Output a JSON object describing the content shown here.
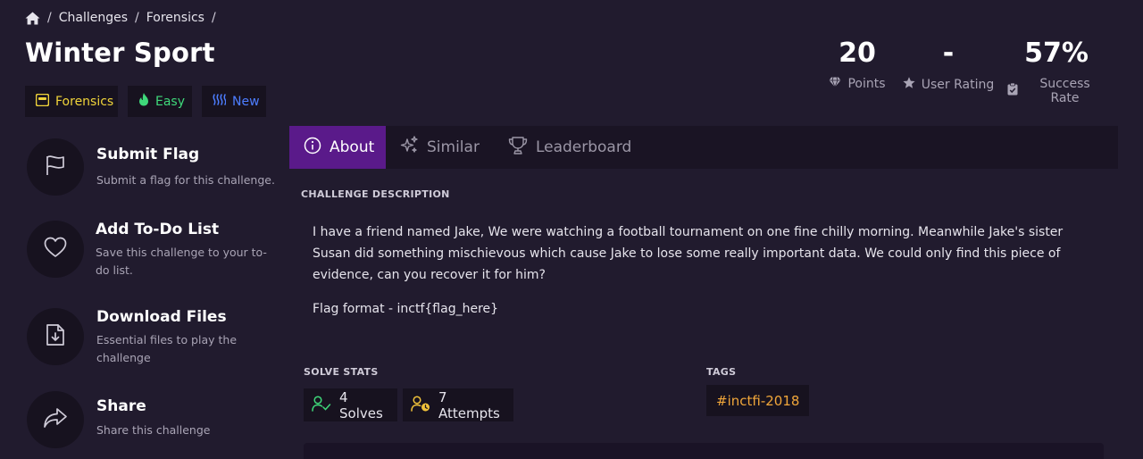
{
  "breadcrumb": {
    "items": [
      "Challenges",
      "Forensics"
    ],
    "separator": "/"
  },
  "challenge": {
    "title": "Winter Sport"
  },
  "badges": {
    "category": "Forensics",
    "difficulty": "Easy",
    "status": "New"
  },
  "stats": {
    "points_value": "20",
    "points_label": "Points",
    "rating_value": "-",
    "rating_label": "User Rating",
    "success_value": "57%",
    "success_label": "Success Rate"
  },
  "actions": [
    {
      "title": "Submit Flag",
      "description": "Submit a flag for this challenge.",
      "icon": "flag-icon"
    },
    {
      "title": "Add To-Do List",
      "description": "Save this challenge to your to-do list.",
      "icon": "heart-icon"
    },
    {
      "title": "Download Files",
      "description": "Essential files to play the challenge",
      "icon": "file-download-icon"
    },
    {
      "title": "Share",
      "description": "Share this challenge",
      "icon": "share-icon"
    }
  ],
  "tabs": [
    {
      "label": "About",
      "active": true,
      "icon": "info-icon"
    },
    {
      "label": "Similar",
      "active": false,
      "icon": "sparkles-icon"
    },
    {
      "label": "Leaderboard",
      "active": false,
      "icon": "trophy-icon"
    }
  ],
  "description": {
    "label": "CHALLENGE DESCRIPTION",
    "text": "I have a friend named Jake, We were watching a football tournament on one fine chilly morning. Meanwhile Jake's sister Susan did something mischievous which cause Jake to lose some really important data. We could only find this piece of evidence, can you recover it for him?",
    "flag_format": "Flag format - inctf{flag_here}"
  },
  "solve_stats": {
    "label": "SOLVE STATS",
    "solves": "4 Solves",
    "attempts": "7 Attempts"
  },
  "tags": {
    "label": "TAGS",
    "items": [
      "#inctfi-2018"
    ]
  },
  "colors": {
    "background": "#211b2e",
    "panel": "#17121f",
    "accent_purple": "#5a1a8a",
    "forensics_yellow": "#f0d43a",
    "easy_green": "#3fd87a",
    "new_blue": "#4d7dff",
    "tag_orange": "#f0a63a"
  }
}
